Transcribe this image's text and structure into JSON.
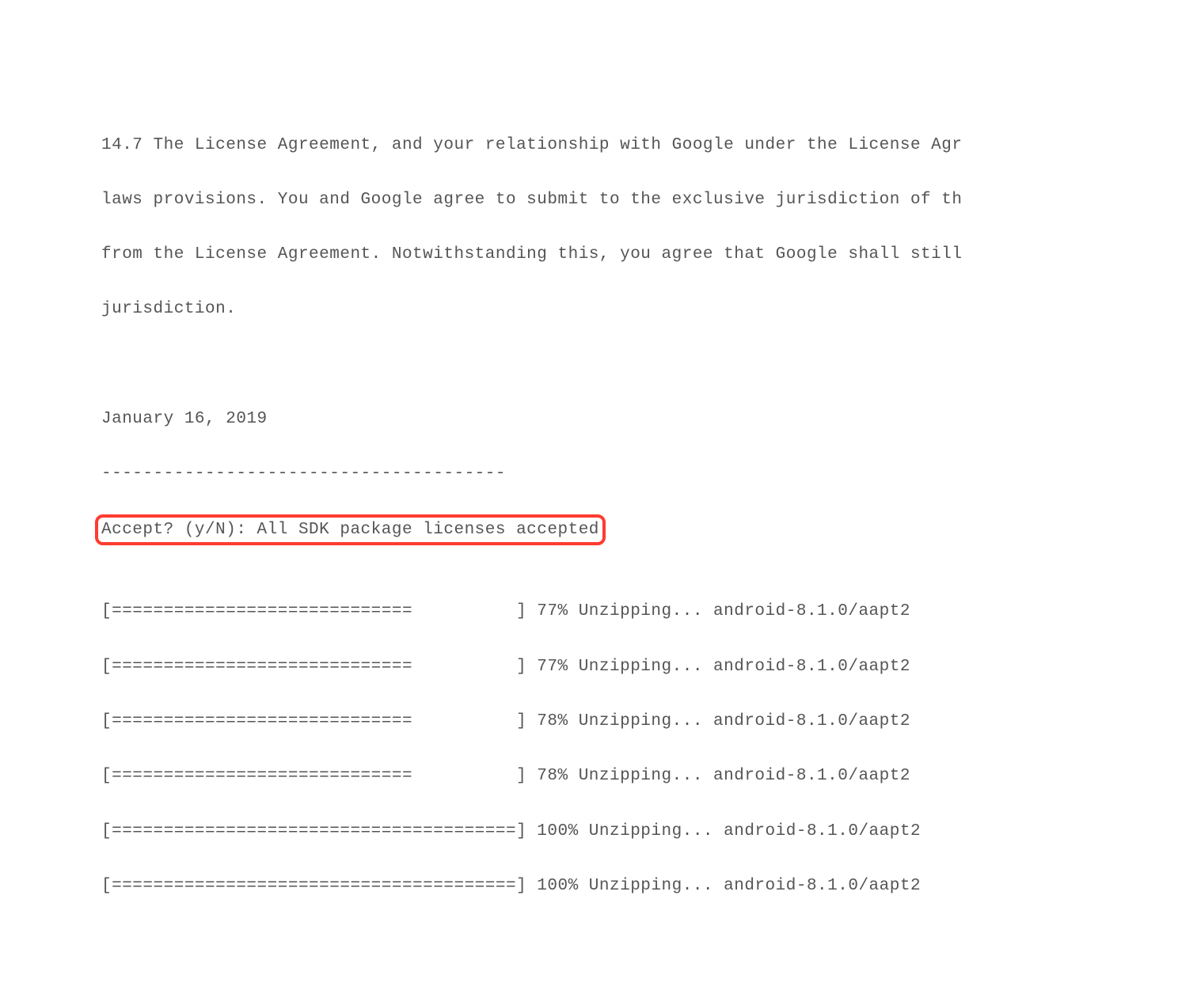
{
  "license": {
    "line1": "14.7 The License Agreement, and your relationship with Google under the License Agr",
    "line2": "laws provisions. You and Google agree to submit to the exclusive jurisdiction of th",
    "line3": "from the License Agreement. Notwithstanding this, you agree that Google shall still",
    "line4": "jurisdiction."
  },
  "blank1": "",
  "blank2": "",
  "date": "January 16, 2019",
  "separator": "---------------------------------------",
  "accept_prompt": "Accept? (y/N): All SDK package licenses accepted",
  "blank3": "",
  "progress": [
    {
      "bar": "[=============================          ] 77% Unzipping... android-8.1.0/aapt2"
    },
    {
      "bar": "[=============================          ] 77% Unzipping... android-8.1.0/aapt2"
    },
    {
      "bar": "[=============================          ] 78% Unzipping... android-8.1.0/aapt2"
    },
    {
      "bar": "[=============================          ] 78% Unzipping... android-8.1.0/aapt2"
    },
    {
      "bar": "[=======================================] 100% Unzipping... android-8.1.0/aapt2"
    },
    {
      "bar": "[=======================================] 100% Unzipping... android-8.1.0/aapt2"
    }
  ]
}
